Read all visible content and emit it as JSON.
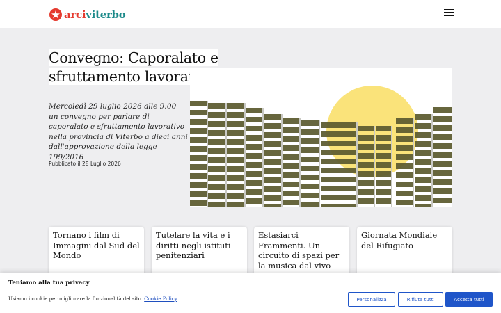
{
  "header": {
    "logo": {
      "text_primary": "arci",
      "text_accent": "viterbo",
      "primary_color": "#e53a2e",
      "accent_color": "#1c8a8a"
    },
    "menu_icon": "hamburger-menu-icon"
  },
  "article": {
    "title": "Convegno: Caporalato e sfruttamento lavorativo",
    "excerpt": "Mercoledì 29 luglio 2026 alle 9:00 un convegno per parlare di caporalato e sfruttamento lavorativo nella provincia di Viterbo a dieci anni dall'approvazione della legge 199/2016",
    "published": "Pubblicato il 28 Luglio 2026",
    "hero_colors": {
      "sun": "#fae37a",
      "bars": "#5b5a2e",
      "background": "#ffffff"
    }
  },
  "related": [
    {
      "title": "Tornano i film di Immagini dal Sud del Mondo"
    },
    {
      "title": "Tutelare la vita e i diritti negli istituti penitenziari"
    },
    {
      "title": "Estasiarci Frammenti. Un circuito di spazi per la musica dal vivo"
    },
    {
      "title": "Giornata Mondiale del Rifugiato"
    }
  ],
  "cookie_banner": {
    "title": "Teniamo alla tua privacy",
    "text": "Usiamo i cookie per migliorare la funzionalità del sito.",
    "link": "Cookie Policy",
    "buttons": {
      "customize": "Personalizza",
      "reject": "Rifiuta tutti",
      "accept": "Accetta tutti"
    },
    "button_color": "#1f55c9"
  }
}
